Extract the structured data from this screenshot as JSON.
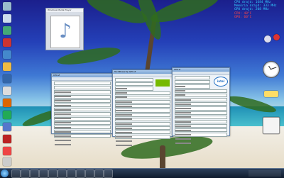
{
  "gadget": {
    "line1": "CPU drajd: 1684 MHz",
    "line2": "Memória drajd: 333 MHz",
    "line3": "GPU drajd: 208 MHz",
    "line4": "CPU: 48°C",
    "line5": "GPU: 60°C"
  },
  "media_player": {
    "title": "Windows Media Player"
  },
  "windows": {
    "cpuz_left": "CPU-Z",
    "gpuz": "TechPowerUp GPU-Z",
    "cpuz_right": "CPU-Z"
  },
  "intel_logo": "intel",
  "colors": {
    "gadget_text": "#33ccff",
    "gadget_alert": "#ff4444",
    "taskbar": "#14233a"
  }
}
